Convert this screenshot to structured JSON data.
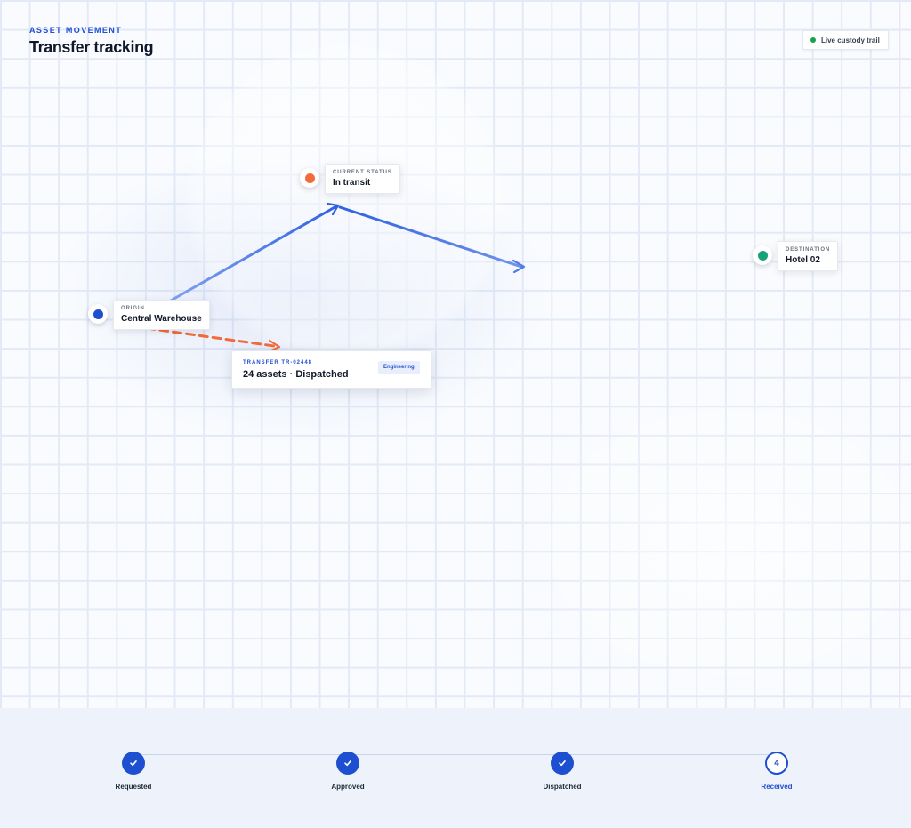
{
  "header": {
    "eyebrow": "ASSET MOVEMENT",
    "title": "Transfer tracking"
  },
  "legend": {
    "label": "Live custody trail",
    "dot_color": "#16a34a"
  },
  "locations": {
    "origin": {
      "label": "ORIGIN",
      "name": "Central Warehouse",
      "color": "#1f4fd1"
    },
    "current": {
      "label": "CURRENT STATUS",
      "name": "In transit",
      "color": "#f26b3a"
    },
    "destination": {
      "label": "DESTINATION",
      "name": "Hotel 02",
      "color": "#16a37a"
    }
  },
  "transfer": {
    "id": "TRANSFER TR-02448",
    "summary": "24 assets · Dispatched",
    "department": "Engineering"
  },
  "routes": {
    "traveled_color": "#2f62e0",
    "projected_color": "#f26b3a"
  },
  "steps": [
    {
      "label": "Requested",
      "state": "done"
    },
    {
      "label": "Approved",
      "state": "done"
    },
    {
      "label": "Dispatched",
      "state": "done"
    },
    {
      "label": "Received",
      "state": "current",
      "number": "4"
    }
  ]
}
